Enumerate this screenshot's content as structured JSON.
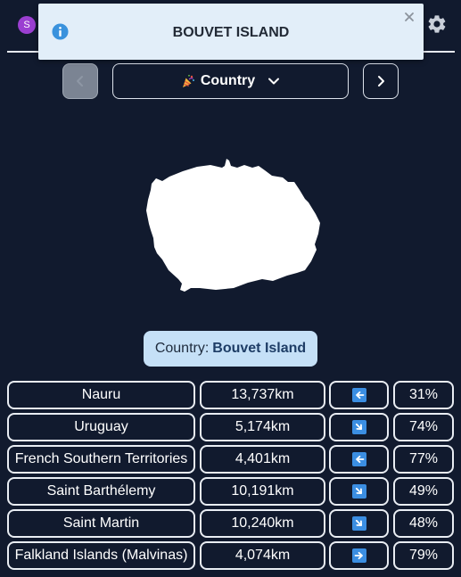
{
  "header": {
    "avatar_letter": "S",
    "settings_icon": "gear-icon"
  },
  "toast": {
    "icon": "info-icon",
    "title": "BOUVET ISLAND",
    "close_icon": "close-icon"
  },
  "nav": {
    "prev_icon": "chevron-left-icon",
    "next_icon": "chevron-right-icon",
    "mode_emoji": "party-popper-icon",
    "mode_label": "Country",
    "mode_dropdown_icon": "chevron-down-icon"
  },
  "shape": {
    "country": "Bouvet Island",
    "fill_color": "#ffffff"
  },
  "answer": {
    "prefix": "Country:",
    "name": "Bouvet Island"
  },
  "guesses": [
    {
      "name": "Nauru",
      "distance": "13,737km",
      "direction": "west",
      "percent": "31%"
    },
    {
      "name": "Uruguay",
      "distance": "5,174km",
      "direction": "south-east",
      "percent": "74%"
    },
    {
      "name": "French Southern Territories",
      "distance": "4,401km",
      "direction": "west",
      "percent": "77%"
    },
    {
      "name": "Saint Barthélemy",
      "distance": "10,191km",
      "direction": "south-east",
      "percent": "49%"
    },
    {
      "name": "Saint Martin",
      "distance": "10,240km",
      "direction": "south-east",
      "percent": "48%"
    },
    {
      "name": "Falkland Islands (Malvinas)",
      "distance": "4,074km",
      "direction": "east",
      "percent": "79%"
    }
  ],
  "colors": {
    "background": "#111a2e",
    "toast_bg": "#e2eef9",
    "info_blue": "#3a92dd",
    "answer_bg": "#c5e0f7",
    "arrow_blue": "#3b8ee2",
    "avatar": "#9b3fd1"
  }
}
